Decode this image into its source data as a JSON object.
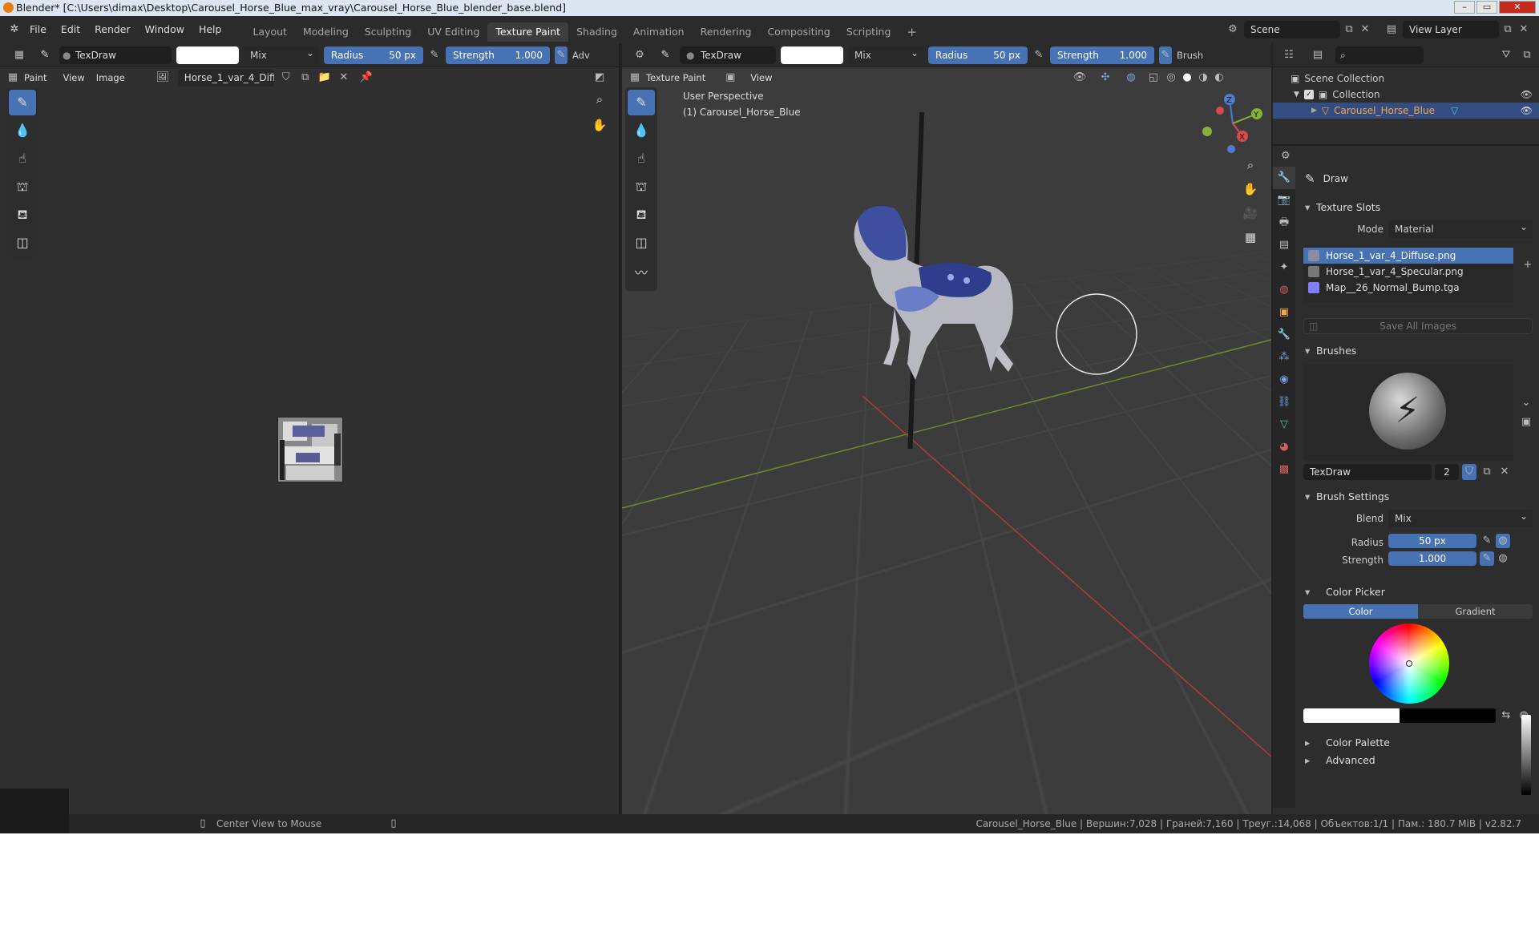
{
  "window": {
    "title": "Blender* [C:\\Users\\dimax\\Desktop\\Carousel_Horse_Blue_max_vray\\Carousel_Horse_Blue_blender_base.blend]"
  },
  "menu": [
    "File",
    "Edit",
    "Render",
    "Window",
    "Help"
  ],
  "workspaces": [
    "Layout",
    "Modeling",
    "Sculpting",
    "UV Editing",
    "Texture Paint",
    "Shading",
    "Animation",
    "Rendering",
    "Compositing",
    "Scripting"
  ],
  "active_workspace": "Texture Paint",
  "scene": {
    "scene_label": "Scene",
    "view_layer_label": "View Layer"
  },
  "brush": {
    "name": "TexDraw",
    "blend": "Mix",
    "radius_label": "Radius",
    "radius": "50 px",
    "strength_label": "Strength",
    "strength": "1.000",
    "adv": "Adv",
    "brush_menu": "Brush",
    "users": "2",
    "color": "#ffffff"
  },
  "image_editor": {
    "mode": "Paint",
    "menus": [
      "View",
      "Image"
    ],
    "image_name": "Horse_1_var_4_Diff..."
  },
  "viewport": {
    "mode": "Texture Paint",
    "menu": "View",
    "overlay_line1": "User Perspective",
    "overlay_line2": "(1) Carousel_Horse_Blue"
  },
  "outliner": {
    "root": "Scene Collection",
    "collection": "Collection",
    "object": "Carousel_Horse_Blue"
  },
  "properties": {
    "tool_name": "Draw",
    "texture_slots": {
      "title": "Texture Slots",
      "mode_label": "Mode",
      "mode": "Material",
      "slots": [
        {
          "name": "Horse_1_var_4_Diffuse.png",
          "color": "#8a8aa0"
        },
        {
          "name": "Horse_1_var_4_Specular.png",
          "color": "#777777"
        },
        {
          "name": "Map__26_Normal_Bump.tga",
          "color": "#8080ff"
        }
      ],
      "save_all": "Save All Images"
    },
    "brushes": {
      "title": "Brushes"
    },
    "brush_settings": {
      "title": "Brush Settings",
      "blend_label": "Blend",
      "radius_label": "Radius",
      "strength_label": "Strength"
    },
    "color_picker": {
      "title": "Color Picker",
      "tab_color": "Color",
      "tab_gradient": "Gradient"
    },
    "color_palette": "Color Palette",
    "advanced": "Advanced"
  },
  "status": {
    "left": "Center View to Mouse",
    "right": "Carousel_Horse_Blue | Вершин:7,028 | Граней:7,160 | Треуг.:14,068 | Объектов:1/1 | Пам.: 180.7 MiB | v2.82.7"
  },
  "colors": {
    "accent": "#4772b3",
    "bg": "#303030"
  }
}
